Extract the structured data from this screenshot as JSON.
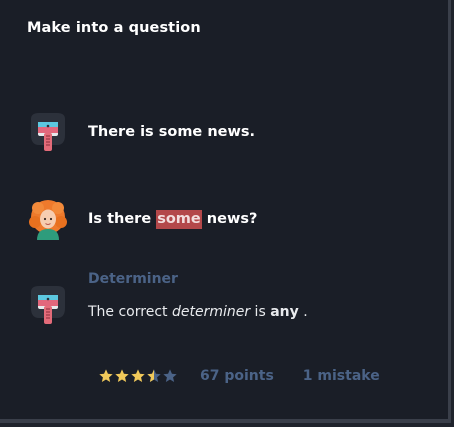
{
  "header": {
    "title": "Make into a question"
  },
  "conversation": {
    "line1": {
      "text": "There is some news."
    },
    "line2": {
      "before": "Is there ",
      "highlight": "some",
      "after": " news?"
    },
    "feedback": {
      "label": "Determiner",
      "text_part1": "The correct ",
      "text_em": "determiner",
      "text_part2": " is ",
      "answer": "any",
      "text_end": " ."
    }
  },
  "result": {
    "rating": 3.5,
    "rating_max": 5,
    "points_text": "67 points",
    "mistakes_text": "1 mistake"
  },
  "colors": {
    "background": "#1a1e27",
    "highlight": "#b3484a",
    "muted_blue": "#4b6387",
    "star_gold": "#f1c95a",
    "star_empty": "#4b6387"
  },
  "icons": {
    "bot_avatar": "robot-bucket-icon",
    "user_avatar": "red-haired-woman-icon",
    "star_full": "star-icon",
    "star_half": "star-half-icon",
    "star_empty": "star-empty-icon"
  }
}
